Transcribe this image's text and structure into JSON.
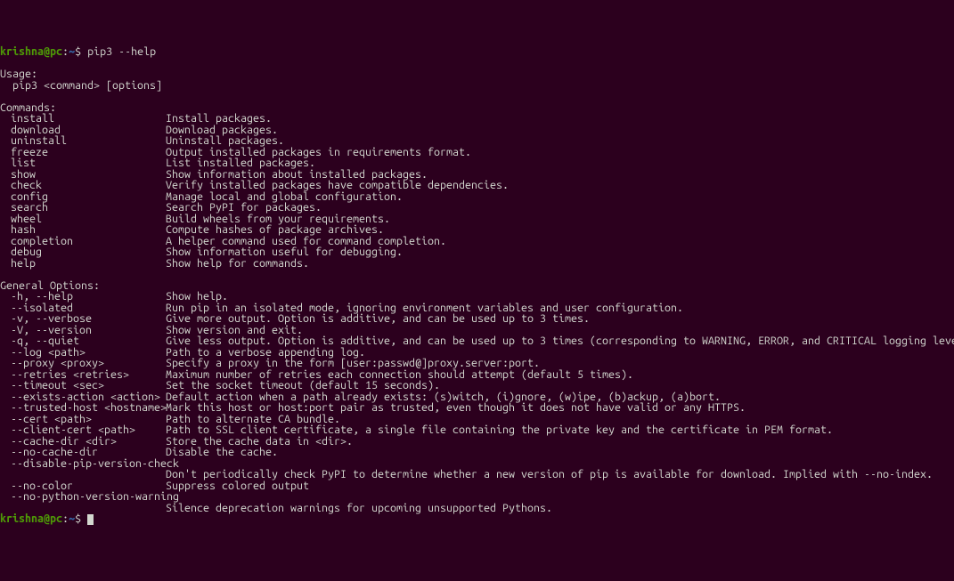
{
  "prompt": {
    "user": "krishna",
    "host": "pc",
    "sep_at": "@",
    "colon": ":",
    "cwd": "~",
    "sigil": "$"
  },
  "command": "pip3 --help",
  "blank": "",
  "usage_header": "Usage:",
  "usage_line": "  pip3 <command> [options]",
  "commands_header": "Commands:",
  "commands": [
    {
      "name": "install",
      "desc": "Install packages."
    },
    {
      "name": "download",
      "desc": "Download packages."
    },
    {
      "name": "uninstall",
      "desc": "Uninstall packages."
    },
    {
      "name": "freeze",
      "desc": "Output installed packages in requirements format."
    },
    {
      "name": "list",
      "desc": "List installed packages."
    },
    {
      "name": "show",
      "desc": "Show information about installed packages."
    },
    {
      "name": "check",
      "desc": "Verify installed packages have compatible dependencies."
    },
    {
      "name": "config",
      "desc": "Manage local and global configuration."
    },
    {
      "name": "search",
      "desc": "Search PyPI for packages."
    },
    {
      "name": "wheel",
      "desc": "Build wheels from your requirements."
    },
    {
      "name": "hash",
      "desc": "Compute hashes of package archives."
    },
    {
      "name": "completion",
      "desc": "A helper command used for command completion."
    },
    {
      "name": "debug",
      "desc": "Show information useful for debugging."
    },
    {
      "name": "help",
      "desc": "Show help for commands."
    }
  ],
  "options_header": "General Options:",
  "options": [
    {
      "name": "-h, --help",
      "desc": "Show help."
    },
    {
      "name": "--isolated",
      "desc": "Run pip in an isolated mode, ignoring environment variables and user configuration."
    },
    {
      "name": "-v, --verbose",
      "desc": "Give more output. Option is additive, and can be used up to 3 times."
    },
    {
      "name": "-V, --version",
      "desc": "Show version and exit."
    },
    {
      "name": "-q, --quiet",
      "desc": "Give less output. Option is additive, and can be used up to 3 times (corresponding to WARNING, ERROR, and CRITICAL logging levels)."
    },
    {
      "name": "--log <path>",
      "desc": "Path to a verbose appending log."
    },
    {
      "name": "--proxy <proxy>",
      "desc": "Specify a proxy in the form [user:passwd@]proxy.server:port."
    },
    {
      "name": "--retries <retries>",
      "desc": "Maximum number of retries each connection should attempt (default 5 times)."
    },
    {
      "name": "--timeout <sec>",
      "desc": "Set the socket timeout (default 15 seconds)."
    },
    {
      "name": "--exists-action <action>",
      "desc": "Default action when a path already exists: (s)witch, (i)gnore, (w)ipe, (b)ackup, (a)bort."
    },
    {
      "name": "--trusted-host <hostname>",
      "desc": "Mark this host or host:port pair as trusted, even though it does not have valid or any HTTPS."
    },
    {
      "name": "--cert <path>",
      "desc": "Path to alternate CA bundle."
    },
    {
      "name": "--client-cert <path>",
      "desc": "Path to SSL client certificate, a single file containing the private key and the certificate in PEM format."
    },
    {
      "name": "--cache-dir <dir>",
      "desc": "Store the cache data in <dir>."
    },
    {
      "name": "--no-cache-dir",
      "desc": "Disable the cache."
    },
    {
      "name": "--disable-pip-version-check",
      "desc": ""
    },
    {
      "name": "",
      "desc": "Don't periodically check PyPI to determine whether a new version of pip is available for download. Implied with --no-index."
    },
    {
      "name": "--no-color",
      "desc": "Suppress colored output"
    },
    {
      "name": "--no-python-version-warning",
      "desc": ""
    },
    {
      "name": "",
      "desc": "Silence deprecation warnings for upcoming unsupported Pythons."
    }
  ]
}
